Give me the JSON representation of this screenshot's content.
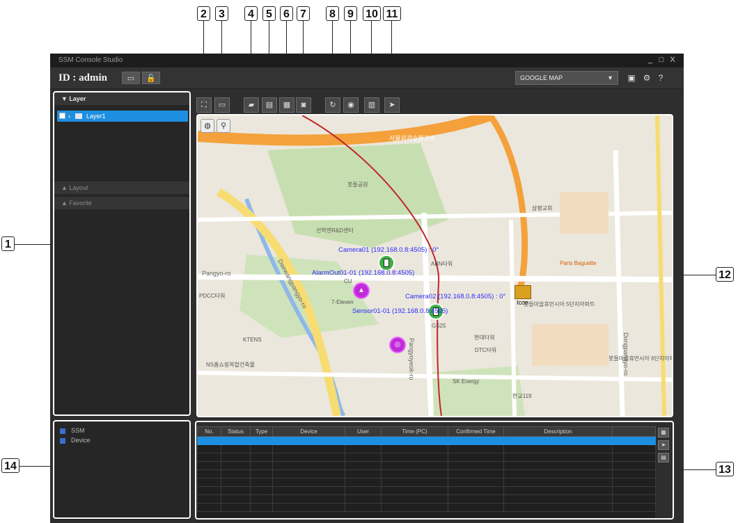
{
  "callouts": [
    "1",
    "2",
    "3",
    "4",
    "5",
    "6",
    "7",
    "8",
    "9",
    "10",
    "11",
    "12",
    "13",
    "14"
  ],
  "window": {
    "title": "SSM Console Studio",
    "controls": [
      "_",
      "□",
      "X"
    ]
  },
  "idbar": {
    "id_label": "ID : admin",
    "map_select": "GOOGLE MAP",
    "icons": [
      "folder-icon",
      "lock-icon",
      "save-icon",
      "gear-icon",
      "help-icon"
    ]
  },
  "left_panel": {
    "layer_header": "Layer",
    "layer_item": "Layer1",
    "layout_header": "Layout",
    "favorite_header": "Favorite"
  },
  "toolbar": {
    "buttons": [
      "fit-icon",
      "window-icon",
      "select-icon",
      "ruler-icon",
      "device-icon",
      "lock-icon",
      "refresh-icon",
      "camera-icon",
      "print-icon",
      "export-icon"
    ]
  },
  "map": {
    "controls": [
      "globe-icon",
      "zoom-icon"
    ],
    "devices": {
      "camera1": "Camera01 (192.168.0.8:4505) : 0°",
      "camera2": "Camera02 (192.168.0.8:4505) : 0°",
      "alarm": "AlarmOut01-01 (192.168.0.8:4505)",
      "sensor": "Sensor01-01 (192.168.0.8:4505)",
      "icon_label": "Icon"
    },
    "place_labels": [
      "서울외곽순환고속",
      "봇들공원",
      "선학엔R&D센터",
      "ABN타워",
      "7-Eleven",
      "CU",
      "GS25",
      "현대타워",
      "DTC타워",
      "SK Energy",
      "KTENS",
      "NS홈쇼핑복합건축물",
      "Paris Baguette",
      "판교119",
      "PDCC타워",
      "삼평교회",
      "봇들마을휴먼시아 5단지아파트",
      "봇들마을휴먼시아 6단지아파트"
    ],
    "road_labels": [
      "Daewangpangyo-ro",
      "Pangyo-ro",
      "Pangyoyeok-ro",
      "Dongpangyo-ro"
    ]
  },
  "bottom_left": {
    "items": [
      "SSM",
      "Device"
    ]
  },
  "events": {
    "columns": [
      "No.",
      "Status",
      "Type",
      "Device",
      "User",
      "Time (PC)",
      "Confirmed Time",
      "Description",
      ""
    ],
    "side_buttons": [
      "grid-icon",
      "send-icon",
      "export-icon"
    ]
  }
}
